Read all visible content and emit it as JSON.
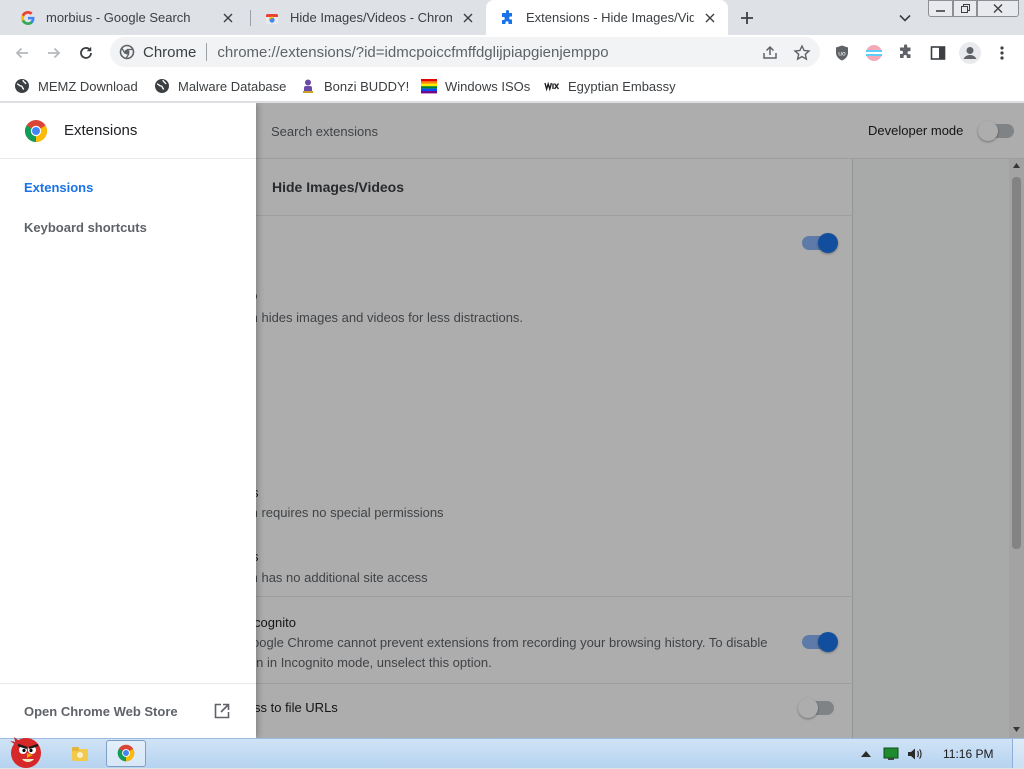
{
  "tabs": [
    {
      "title": "morbius - Google Search",
      "icon": "google-g-icon",
      "active": false
    },
    {
      "title": "Hide Images/Videos - Chrome",
      "icon": "chrome-web-store-icon",
      "active": false
    },
    {
      "title": "Extensions - Hide Images/Videos",
      "icon": "puzzle-piece-icon",
      "active": true
    }
  ],
  "toolbar": {
    "site_label": "Chrome",
    "url": "chrome://extensions/?id=idmcpoiccfmffdglijpiapgienjemppo"
  },
  "bookmarks": [
    {
      "label": "MEMZ Download",
      "icon": "globe-icon"
    },
    {
      "label": "Malware Database",
      "icon": "globe-icon"
    },
    {
      "label": "Bonzi BUDDY!",
      "icon": "bonzi-icon"
    },
    {
      "label": "Windows ISOs",
      "icon": "rainbow-flag-icon"
    },
    {
      "label": "Egyptian Embassy",
      "icon": "wix-icon"
    }
  ],
  "drawer": {
    "title": "Extensions",
    "nav": [
      {
        "label": "Extensions",
        "selected": true
      },
      {
        "label": "Keyboard shortcuts",
        "selected": false
      }
    ],
    "footer_link": "Open Chrome Web Store"
  },
  "header": {
    "search_placeholder": "Search extensions",
    "developer_mode_label": "Developer mode",
    "developer_mode_on": false
  },
  "details": {
    "name": "Hide Images/Videos",
    "enabled": true,
    "description_heading": "D",
    "description": "sion hides images and videos for less distractions.",
    "permissions_heading": "s",
    "permissions_text": "sion requires no special permissions",
    "site_access_heading": "s",
    "site_access_text": "sion has no additional site access",
    "incognito_heading": "cognito",
    "incognito_line1": "oogle Chrome cannot prevent extensions from recording your browsing history. To disable",
    "incognito_line2": "ion in Incognito mode, unselect this option.",
    "incognito_enabled": true,
    "file_urls_label": "ss to file URLs",
    "file_urls_enabled": false
  },
  "taskbar": {
    "time": "11:16 PM"
  },
  "colors": {
    "accent": "#1a73e8",
    "nav_selected": "#1a73e8",
    "taskbar": "#b6d3f0"
  }
}
